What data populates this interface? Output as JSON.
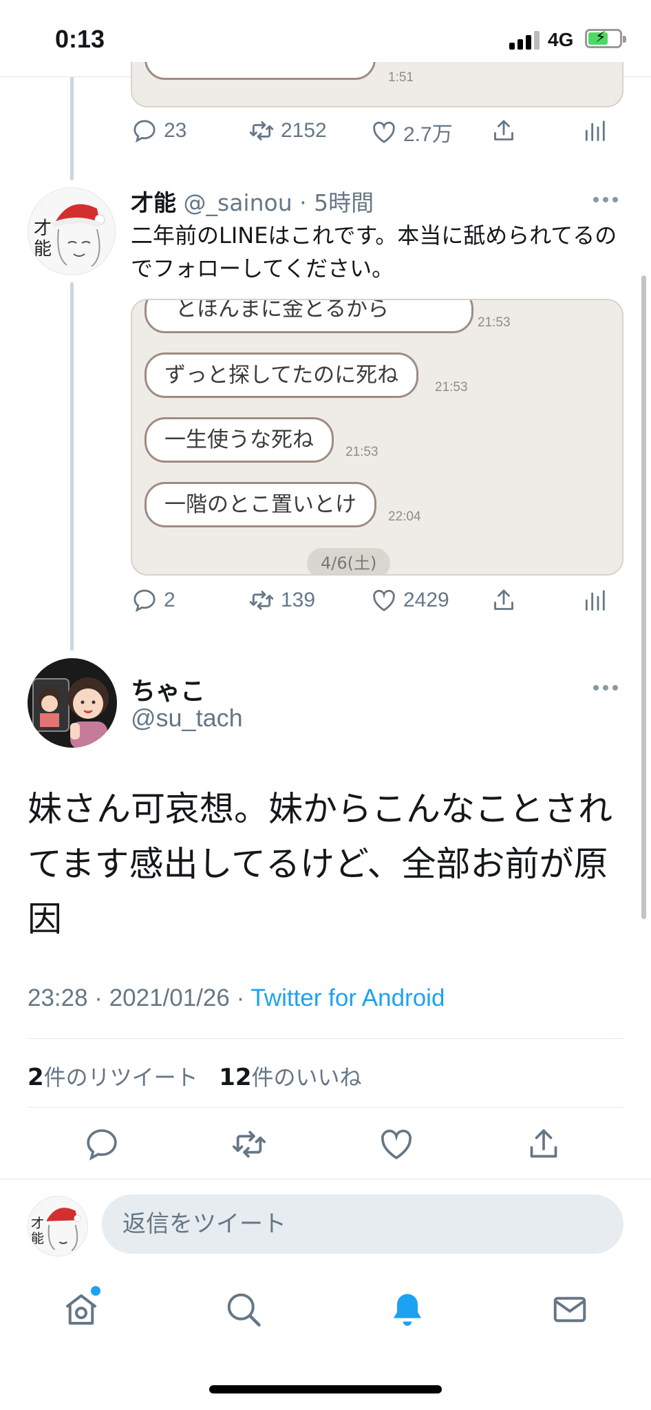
{
  "status_bar": {
    "time": "0:13",
    "network": "4G"
  },
  "prev_tweet": {
    "bubble_time": "1:51",
    "actions": {
      "replies": "23",
      "retweets": "2152",
      "likes": "2.7万"
    }
  },
  "tweet2": {
    "name": "才能",
    "handle": "@_sainou",
    "separator": "·",
    "time": "5時間",
    "text": "二年前のLINEはこれです。本当に舐められてるのでフォローしてください。",
    "avatar_label": "才能",
    "chat": {
      "messages": [
        {
          "text": "とほんまに金とるから",
          "time": "21:53"
        },
        {
          "text": "ずっと探してたのに死ね",
          "time": "21:53"
        },
        {
          "text": "一生使うな死ね",
          "time": "21:53"
        },
        {
          "text": "一階のとこ置いとけ",
          "time": "22:04"
        }
      ],
      "date": "4/6(土)"
    },
    "actions": {
      "replies": "2",
      "retweets": "139",
      "likes": "2429"
    }
  },
  "main_tweet": {
    "name": "ちゃこ",
    "handle": "@su_tach",
    "text": "妹さん可哀想。妹からこんなことされてます感出してるけど、全部お前が原因",
    "timestamp": "23:28 · 2021/01/26 · ",
    "source": "Twitter for Android",
    "retweet_count": "2",
    "retweet_label": "件のリツイート",
    "like_count": "12",
    "like_label": "件のいいね"
  },
  "reply_bar": {
    "placeholder": "返信をツイート",
    "avatar_label": "才能"
  },
  "tab_bar": {
    "items": [
      {
        "icon": "home-icon",
        "label": "home"
      },
      {
        "icon": "search-icon",
        "label": "search"
      },
      {
        "icon": "bell-icon",
        "label": "notifications"
      },
      {
        "icon": "mail-icon",
        "label": "messages"
      }
    ],
    "active": "notifications"
  },
  "colors": {
    "accent": "#1da1f2",
    "muted": "#657786",
    "chat_bg": "#efece7"
  }
}
